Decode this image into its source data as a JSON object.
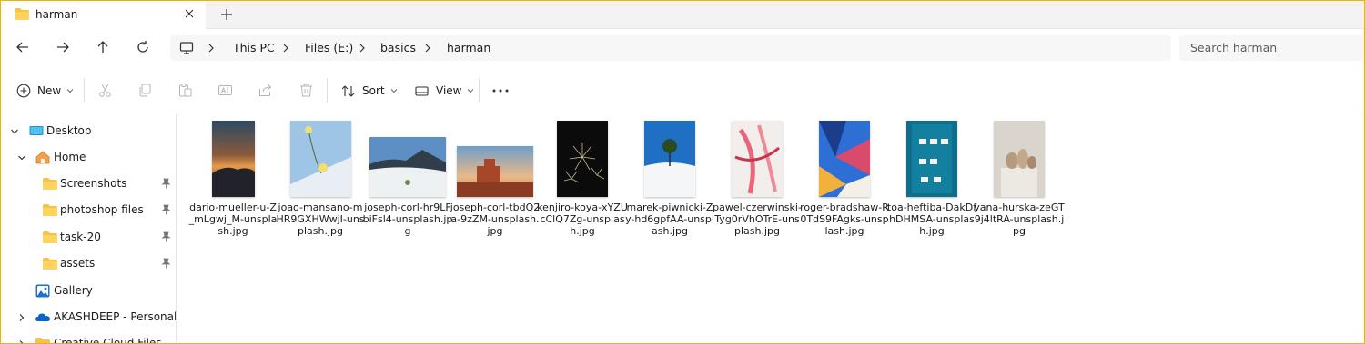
{
  "tab": {
    "title": "harman"
  },
  "breadcrumbs": [
    "This PC",
    "Files (E:)",
    "basics",
    "harman"
  ],
  "search": {
    "placeholder": "Search harman"
  },
  "commands": {
    "new_label": "New",
    "sort_label": "Sort",
    "view_label": "View"
  },
  "nav": {
    "items": [
      {
        "label": "Desktop",
        "icon": "desktop-icon"
      },
      {
        "label": "Home",
        "icon": "home-icon"
      },
      {
        "label": "Screenshots",
        "icon": "folder-icon",
        "pinned": true
      },
      {
        "label": "photoshop files",
        "icon": "folder-icon",
        "pinned": true
      },
      {
        "label": "task-20",
        "icon": "folder-icon",
        "pinned": true
      },
      {
        "label": "assets",
        "icon": "folder-icon",
        "pinned": true
      },
      {
        "label": "Gallery",
        "icon": "gallery-icon"
      },
      {
        "label": "AKASHDEEP - Personal",
        "icon": "onedrive-cloud-icon"
      },
      {
        "label": "Creative Cloud Files...",
        "icon": "folder-icon"
      }
    ]
  },
  "files": [
    {
      "name": "dario-mueller-u-Z_mLgwj_M-unsplash.jpg",
      "orientation": "portrait"
    },
    {
      "name": "joao-mansano-mHR9GXHWwjI-unsplash.jpg",
      "orientation": "portrait"
    },
    {
      "name": "joseph-corl-hr9LFbiFsl4-unsplash.jpg",
      "orientation": "landscape"
    },
    {
      "name": "joseph-corl-tbdQ2a-9zZM-unsplash.jpg",
      "orientation": "landscape"
    },
    {
      "name": "kenjiro-koya-xYZUcClQ7Zg-unsplash.jpg",
      "orientation": "portrait"
    },
    {
      "name": "marek-piwnicki-Zy-hd6gpfAA-unsplash.jpg",
      "orientation": "portrait"
    },
    {
      "name": "pawel-czerwinski-Tyg0rVhOTrE-unsplash.jpg",
      "orientation": "portrait"
    },
    {
      "name": "roger-bradshaw-R0TdS9FAgks-unsplash.jpg",
      "orientation": "portrait"
    },
    {
      "name": "toa-heftiba-DakDfhDHMSA-unsplash.jpg",
      "orientation": "portrait"
    },
    {
      "name": "yana-hurska-zeGT9j4ltRA-unsplash.jpg",
      "orientation": "portrait"
    }
  ],
  "colors": {
    "accent_border": "#f0b400",
    "folder": "#f6c445",
    "onedrive": "#0a64c8"
  }
}
